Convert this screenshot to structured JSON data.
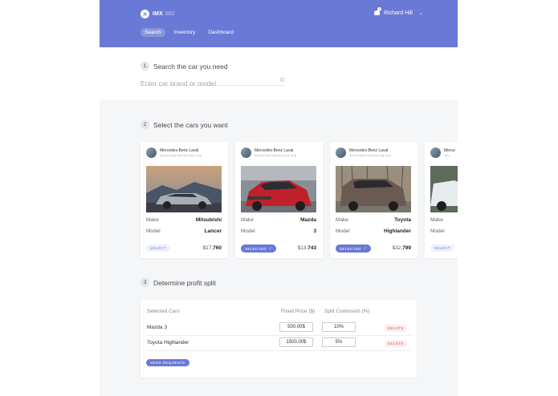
{
  "header": {
    "logo_mark": "✕",
    "logo_name": "IMX",
    "logo_suffix": " 360",
    "notification_count": "2",
    "user_name": "Richard Hill",
    "user_chevron": "⌄"
  },
  "nav": {
    "tabs": [
      {
        "label": "Search",
        "active": true
      },
      {
        "label": "Inventory",
        "active": false
      },
      {
        "label": "Dashboard",
        "active": false
      }
    ]
  },
  "steps": {
    "s1": {
      "num": "1",
      "title": "Search the car you need"
    },
    "s2": {
      "num": "2",
      "title": "Select the cars you want"
    },
    "s3": {
      "num": "3",
      "title": "Determine profit split"
    }
  },
  "search": {
    "placeholder": "Enter car brand or model",
    "icon": "search-icon"
  },
  "cards": [
    {
      "dealer": "Mercedes-Benz Laval",
      "address": "300 Automobile Joan-Noel Laval, Laval",
      "make_label": "Make",
      "make": "Mitsubishi",
      "model_label": "Model",
      "model": "Lancer",
      "badge": "SELECT",
      "selected": false,
      "price_prefix": "$17,",
      "price_bold": "760",
      "car_color": "#a9adb3"
    },
    {
      "dealer": "Mercedes-Benz Laval",
      "address": "300 Automobile Joan-Noel Laval, Laval",
      "make_label": "Make",
      "make": "Mazda",
      "model_label": "Model",
      "model": "3",
      "badge": "SELECTED",
      "selected": true,
      "price_prefix": "$13,",
      "price_bold": "743",
      "car_color": "#c0202a"
    },
    {
      "dealer": "Mercedes-Benz Laval",
      "address": "300 Automobile Joan-Noel Laval, Laval",
      "make_label": "Make",
      "make": "Toyota",
      "model_label": "Model",
      "model": "Highlander",
      "badge": "SELECTED",
      "selected": true,
      "price_prefix": "$32,",
      "price_bold": "799",
      "car_color": "#6b5a52"
    },
    {
      "dealer": "Merce",
      "address": "300 A",
      "make_label": "Make",
      "make": "",
      "model_label": "Model",
      "model": "",
      "badge": "SELECT",
      "selected": false,
      "price_prefix": "",
      "price_bold": "",
      "car_color": "#e8ebee"
    }
  ],
  "profit": {
    "col_car": "Selected Cars",
    "col_price": "Fixed Price ($)",
    "col_commission": "Split Comission (%)",
    "rows": [
      {
        "car": "Mazda 3",
        "price": "500.00$",
        "commission": "10%",
        "action": "DELETE"
      },
      {
        "car": "Toyota Highlander",
        "price": "1500.00$",
        "commission": "5%",
        "action": "DELETE"
      }
    ],
    "send_label": "SEND REQUESTS"
  },
  "colors": {
    "accent": "#6a78d6",
    "danger": "#e05a5a",
    "background": "#f5f6f8"
  }
}
